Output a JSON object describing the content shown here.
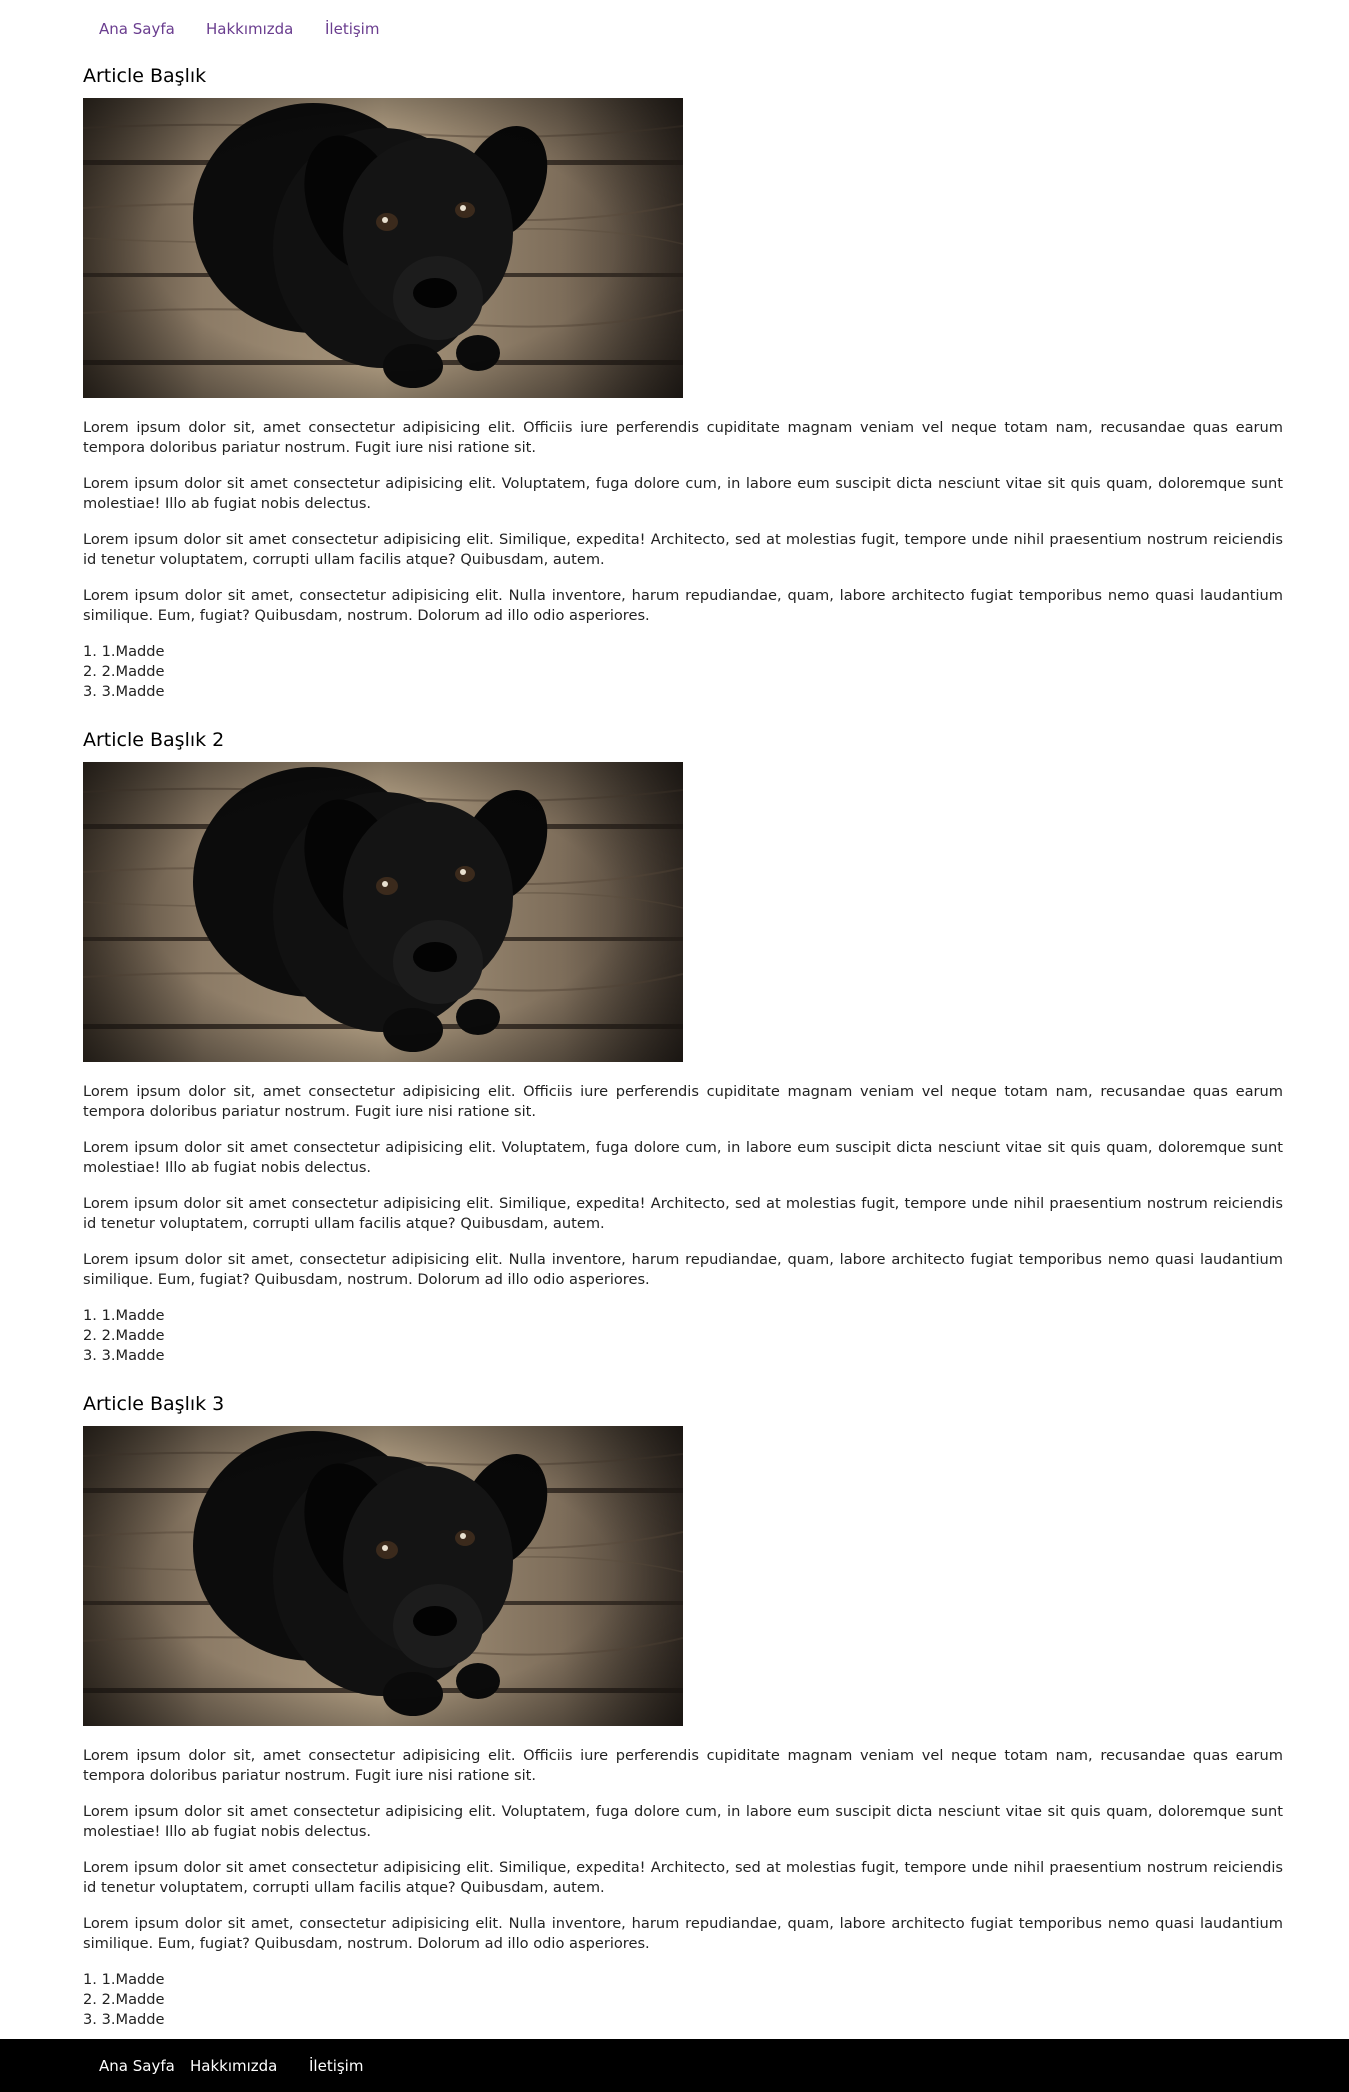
{
  "nav": {
    "items": [
      "Ana Sayfa",
      "Hakkımızda",
      "İletişim"
    ]
  },
  "articles": [
    {
      "title": "Article Başlık",
      "image": "dog-photo",
      "paragraphs": [
        "Lorem ipsum dolor sit, amet consectetur adipisicing elit. Officiis iure perferendis cupiditate magnam veniam vel neque totam nam, recusandae quas earum tempora doloribus pariatur nostrum. Fugit iure nisi ratione sit.",
        "Lorem ipsum dolor sit amet consectetur adipisicing elit. Voluptatem, fuga dolore cum, in labore eum suscipit dicta nesciunt vitae sit quis quam, doloremque sunt molestiae! Illo ab fugiat nobis delectus.",
        "Lorem ipsum dolor sit amet consectetur adipisicing elit. Similique, expedita! Architecto, sed at molestias fugit, tempore unde nihil praesentium nostrum reiciendis id tenetur voluptatem, corrupti ullam facilis atque? Quibusdam, autem.",
        "Lorem ipsum dolor sit amet, consectetur adipisicing elit. Nulla inventore, harum repudiandae, quam, labore architecto fugiat temporibus nemo quasi laudantium similique. Eum, fugiat? Quibusdam, nostrum. Dolorum ad illo odio asperiores."
      ],
      "list": [
        "1. 1.Madde",
        "2. 2.Madde",
        "3. 3.Madde"
      ]
    },
    {
      "title": "Article Başlık 2",
      "image": "dog-photo",
      "paragraphs": [
        "Lorem ipsum dolor sit, amet consectetur adipisicing elit. Officiis iure perferendis cupiditate magnam veniam vel neque totam nam, recusandae quas earum tempora doloribus pariatur nostrum. Fugit iure nisi ratione sit.",
        "Lorem ipsum dolor sit amet consectetur adipisicing elit. Voluptatem, fuga dolore cum, in labore eum suscipit dicta nesciunt vitae sit quis quam, doloremque sunt molestiae! Illo ab fugiat nobis delectus.",
        "Lorem ipsum dolor sit amet consectetur adipisicing elit. Similique, expedita! Architecto, sed at molestias fugit, tempore unde nihil praesentium nostrum reiciendis id tenetur voluptatem, corrupti ullam facilis atque? Quibusdam, autem.",
        "Lorem ipsum dolor sit amet, consectetur adipisicing elit. Nulla inventore, harum repudiandae, quam, labore architecto fugiat temporibus nemo quasi laudantium similique. Eum, fugiat? Quibusdam, nostrum. Dolorum ad illo odio asperiores."
      ],
      "list": [
        "1. 1.Madde",
        "2. 2.Madde",
        "3. 3.Madde"
      ]
    },
    {
      "title": "Article Başlık 3",
      "image": "dog-photo",
      "paragraphs": [
        "Lorem ipsum dolor sit, amet consectetur adipisicing elit. Officiis iure perferendis cupiditate magnam veniam vel neque totam nam, recusandae quas earum tempora doloribus pariatur nostrum. Fugit iure nisi ratione sit.",
        "Lorem ipsum dolor sit amet consectetur adipisicing elit. Voluptatem, fuga dolore cum, in labore eum suscipit dicta nesciunt vitae sit quis quam, doloremque sunt molestiae! Illo ab fugiat nobis delectus.",
        "Lorem ipsum dolor sit amet consectetur adipisicing elit. Similique, expedita! Architecto, sed at molestias fugit, tempore unde nihil praesentium nostrum reiciendis id tenetur voluptatem, corrupti ullam facilis atque? Quibusdam, autem.",
        "Lorem ipsum dolor sit amet, consectetur adipisicing elit. Nulla inventore, harum repudiandae, quam, labore architecto fugiat temporibus nemo quasi laudantium similique. Eum, fugiat? Quibusdam, nostrum. Dolorum ad illo odio asperiores."
      ],
      "list": [
        "1. 1.Madde",
        "2. 2.Madde",
        "3. 3.Madde"
      ]
    }
  ],
  "footer": {
    "items": [
      "Ana Sayfa",
      "Hakkımızda",
      "İletişim"
    ]
  },
  "colors": {
    "nav_link": "#6a3d8f",
    "footer_bg": "#000000",
    "footer_link": "#ffffff"
  }
}
